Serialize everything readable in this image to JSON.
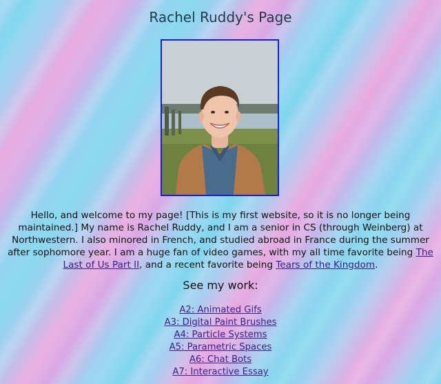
{
  "page": {
    "title": "Rachel Ruddy's Page"
  },
  "intro": {
    "text_1": "Hello, and welcome to my page! [This is my first website, so it is no longer being maintained.] My name is Rachel Ruddy, and I am a senior in CS (through Weinberg) at Northwestern. I also minored in French, and studied abroad in France during the summer after sophomore year. I am a huge fan of video games, with my all time favorite being ",
    "link_1": "The Last of Us Part II",
    "text_2": ", and a recent favorite being ",
    "link_2": "Tears of the Kingdom",
    "text_3": "."
  },
  "works": {
    "heading": "See my work:",
    "items": [
      "A2: Animated Gifs",
      "A3: Digital Paint Brushes",
      "A4: Particle Systems",
      "A5: Parametric Spaces",
      "A6: Chat Bots",
      "A7: Interactive Essay"
    ]
  },
  "colors": {
    "background_blue": "#7fd6ee",
    "background_pink": "#e8a9e0",
    "link": "#3a1f86",
    "photo_border": "#1a1ae0"
  }
}
